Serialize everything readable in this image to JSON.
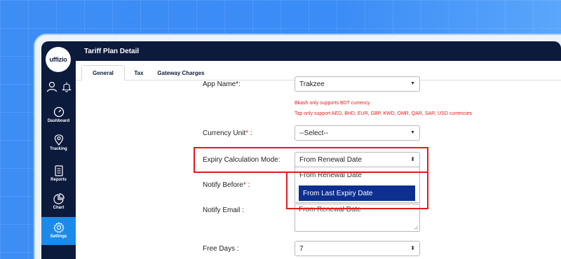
{
  "brand": {
    "logo_text": "uffizio"
  },
  "header": {
    "title": "Tariff Plan Detail"
  },
  "tabs": [
    {
      "label": "General"
    },
    {
      "label": "Tax"
    },
    {
      "label": "Gateway Charges"
    }
  ],
  "sidebar": {
    "items": [
      {
        "label": "Dashboard"
      },
      {
        "label": "Tracking"
      },
      {
        "label": "Reports"
      },
      {
        "label": "Chart"
      },
      {
        "label": "Settings"
      }
    ]
  },
  "form": {
    "app_name": {
      "label": "App Name*:",
      "value": "Trakzee"
    },
    "warnings": [
      "Bkash only supports BDT currency",
      "Tap only support AED, BHD, EUR, GBP, KWD, OMR, QAR, SAR, USD currencies"
    ],
    "currency_unit": {
      "label": "Currency Unit",
      "star": "*",
      "colon": " :",
      "value": "--Select--"
    },
    "expiry_mode": {
      "label": "Expiry Calculation Mode:",
      "value": "From Renewal Date",
      "options": [
        "From Renewal Date",
        "From Last Expiry Date"
      ],
      "highlighted": "From Last Expiry Date"
    },
    "notify_before": {
      "label": "Notify Before",
      "star": "*",
      "colon": " :"
    },
    "notify_email": {
      "label": "Notify Email :",
      "value": "From Renewal Date"
    },
    "free_days": {
      "label": "Free Days :",
      "value": "7"
    }
  },
  "colors": {
    "accent": "#1b8ae8",
    "nav_bg": "#0c1a3c",
    "highlight": "#e01c1c",
    "option_selected": "#0d2f8f"
  }
}
